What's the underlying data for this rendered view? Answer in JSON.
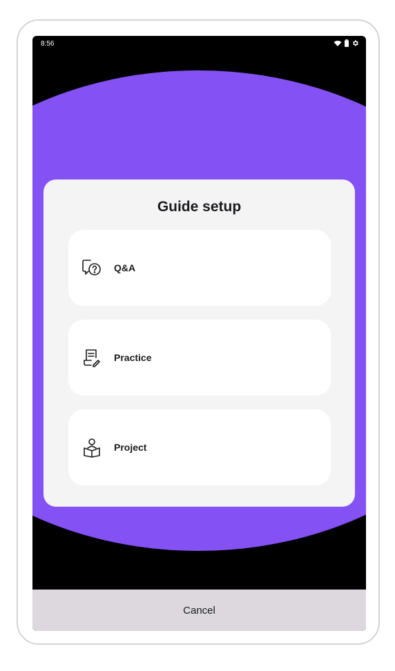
{
  "status_bar": {
    "time": "8:56",
    "icons": [
      "wifi-icon",
      "battery-icon",
      "settings-icon"
    ]
  },
  "dialog": {
    "title": "Guide setup",
    "options": [
      {
        "label": "Q&A",
        "icon": "question-chat-icon"
      },
      {
        "label": "Practice",
        "icon": "document-edit-icon"
      },
      {
        "label": "Project",
        "icon": "reader-book-icon"
      }
    ]
  },
  "footer": {
    "cancel_label": "Cancel"
  },
  "colors": {
    "accent": "#8452f4",
    "background": "#000000",
    "sheet": "#f4f4f5",
    "card": "#ffffff",
    "cancel_bar": "#dcd8dd",
    "text": "#1b1b1f"
  }
}
